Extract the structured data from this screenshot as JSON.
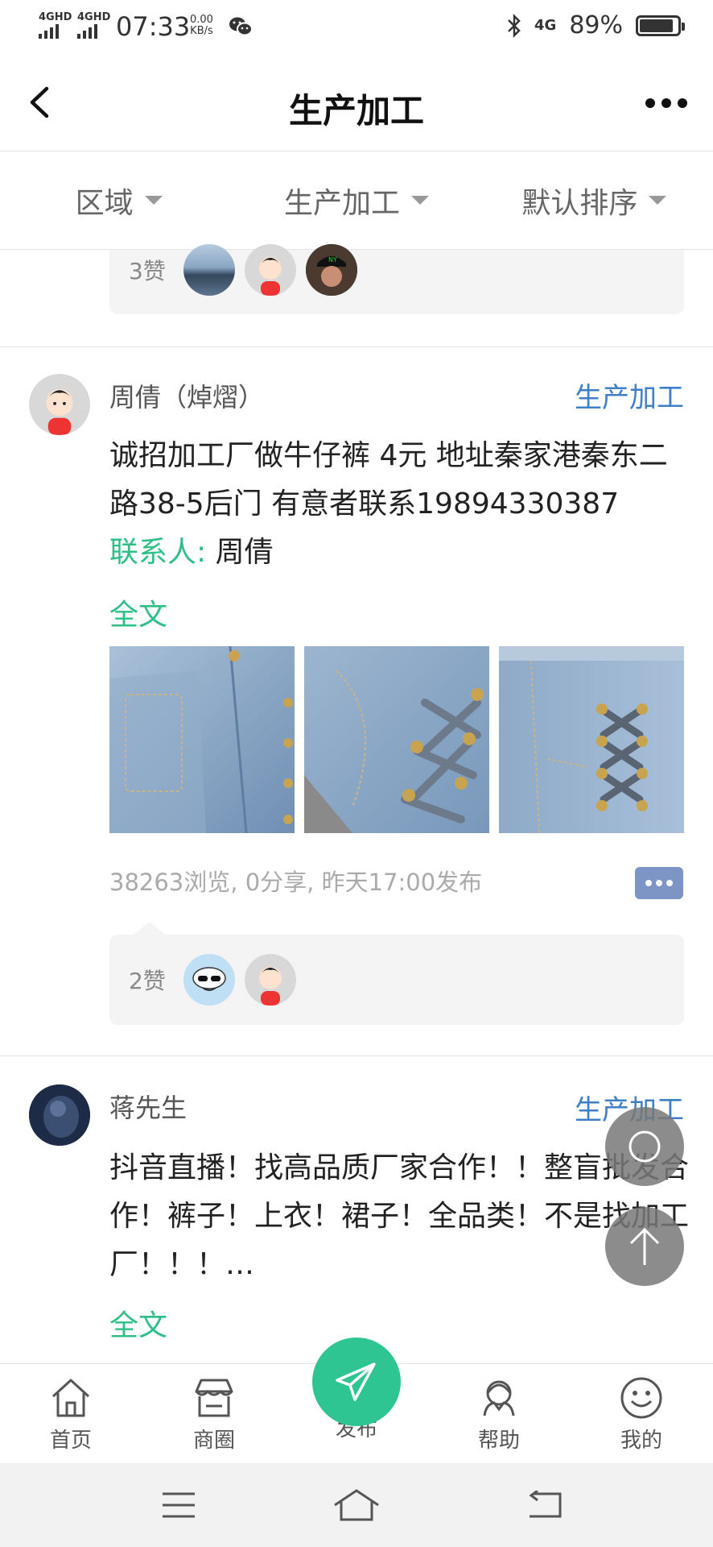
{
  "status_bar": {
    "network1": "4GHD",
    "network2": "4GHD",
    "time": "07:33",
    "speed_value": "0.00",
    "speed_unit": "KB/s",
    "network3": "4G",
    "battery_text": "89%",
    "battery_level": 0.89
  },
  "nav": {
    "title": "生产加工"
  },
  "filters": [
    {
      "label": "区域"
    },
    {
      "label": "生产加工"
    },
    {
      "label": "默认排序"
    }
  ],
  "feed": {
    "prev_likes": "3赞",
    "post1": {
      "author": "周倩（焯熠）",
      "category": "生产加工",
      "content": "诚招加工厂做牛仔裤 4元 地址秦家港秦东二路38-5后门 有意者联系19894330387",
      "contact_label": "联系人:",
      "contact_name": "周倩",
      "fulltext": "全文",
      "meta": "38263浏览, 0分享, 昨天17:00发布",
      "likes": "2赞"
    },
    "post2": {
      "author": "蒋先生",
      "category": "生产加工",
      "content": "抖音直播！找高品质厂家合作！！整盲批发合作！裤子！上衣！裙子！全品类！不是找加工厂！！！…",
      "fulltext": "全文"
    }
  },
  "tabbar": {
    "home": "首页",
    "mall": "商圈",
    "publish": "发布",
    "help": "帮助",
    "mine": "我的"
  },
  "colors": {
    "accent_green": "#2fbf86",
    "category_blue": "#3f7fc6",
    "publish_green": "#2fc592"
  }
}
